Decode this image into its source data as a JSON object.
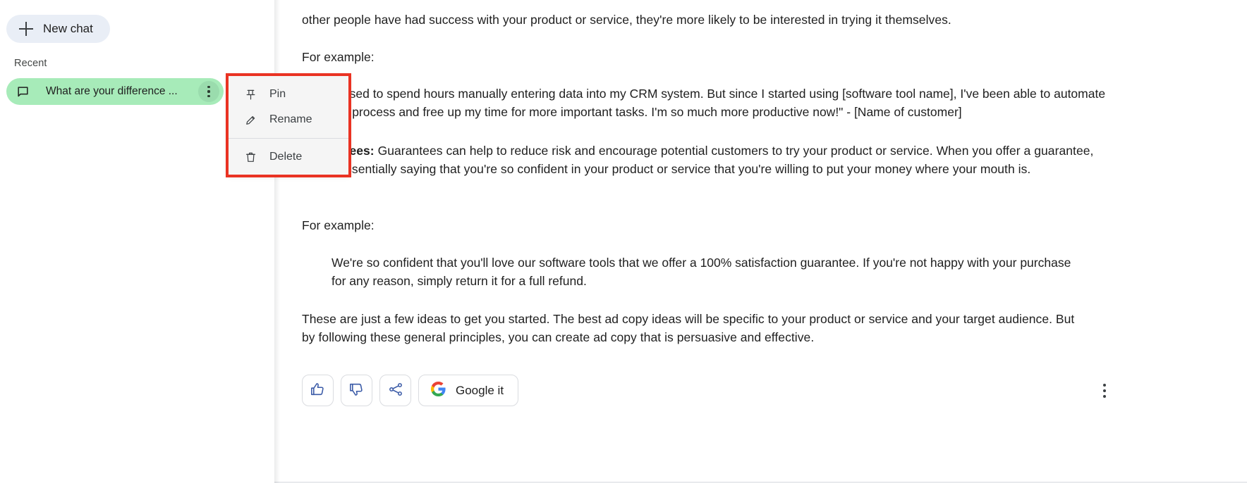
{
  "sidebar": {
    "new_chat_label": "New chat",
    "new_chat_icon": "plus-icon",
    "recent_label": "Recent",
    "chat_icon": "chat-bubble-icon",
    "chats": [
      {
        "title": "What are your difference ...",
        "more_icon": "more-vert-icon",
        "active": true
      }
    ]
  },
  "context_menu": {
    "items": [
      {
        "label": "Pin",
        "icon": "pin-icon"
      },
      {
        "label": "Rename",
        "icon": "pencil-icon"
      },
      {
        "label": "Delete",
        "icon": "trash-icon"
      }
    ],
    "highlight_color": "#ea3323"
  },
  "main": {
    "paragraphs": {
      "p_first": "other people have had success with your product or service, they're more likely to be interested in trying it themselves.",
      "p_for_example_1": "For example:",
      "q_crm": "\"I used to spend hours manually entering data into my CRM system. But since I started using [software tool name], I've been able to automate the process and free up my time for more important tasks. I'm so much more productive now!\" - [Name of customer]",
      "p_guarantees_bold": "Guarantees:",
      "p_guarantees_rest": " Guarantees can help to reduce risk and encourage potential customers to try your product or service. When you offer a guarantee, you're essentially saying that you're so confident in your product or service that you're willing to put your money where your mouth is.",
      "p_for_example_2": "For example:",
      "q_satisfaction": "We're so confident that you'll love our software tools that we offer a 100% satisfaction guarantee. If you're not happy with your purchase for any reason, simply return it for a full refund.",
      "p_last": "These are just a few ideas to get you started. The best ad copy ideas will be specific to your product or service and your target audience. But by following these general principles, you can create ad copy that is persuasive and effective."
    },
    "actions": {
      "thumbs_up_icon": "thumb-up-icon",
      "thumbs_down_icon": "thumb-down-icon",
      "share_icon": "share-icon",
      "google_it_label": "Google it",
      "google_logo_icon": "google-g-icon",
      "more_icon": "more-vert-icon",
      "icon_color": "#3b5ba7"
    }
  }
}
